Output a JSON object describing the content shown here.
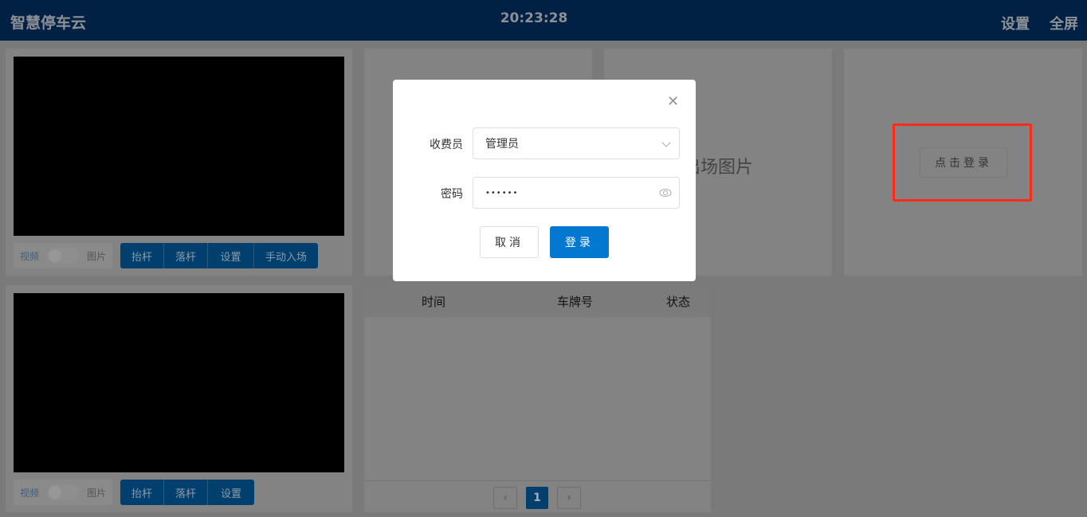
{
  "header": {
    "title": "智慧停车云",
    "clock": "20:23:28",
    "settings": "设置",
    "fullscreen": "全屏"
  },
  "lanes": [
    {
      "toggle": {
        "video": "视频",
        "picture": "图片"
      },
      "buttons": [
        "抬杆",
        "落杆",
        "设置",
        "手动入场"
      ]
    },
    {
      "toggle": {
        "video": "视频",
        "picture": "图片"
      },
      "buttons": [
        "抬杆",
        "落杆",
        "设置"
      ]
    }
  ],
  "exit_image": "出场图片",
  "login_prompt": "点击登录",
  "records_table": {
    "columns": [
      "时间",
      "车牌号",
      "状态"
    ],
    "rows": [],
    "pagination": {
      "current_page": "1"
    }
  },
  "login_dialog": {
    "cashier_label": "收费员",
    "cashier_value": "管理员",
    "password_label": "密码",
    "password_value": "••••••",
    "cancel": "取消",
    "login": "登录"
  },
  "colors": {
    "header": "#002143",
    "primary": "#0378d1",
    "highlight": "#ff2a1a"
  }
}
